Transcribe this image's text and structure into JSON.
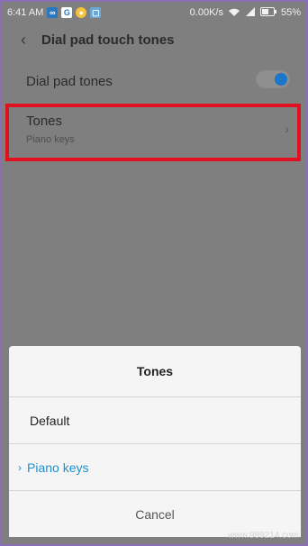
{
  "statusbar": {
    "time": "6:41 AM",
    "speed": "0.00K/s",
    "battery": "55%",
    "icons": [
      "infinity-icon",
      "g-icon",
      "circle-app-icon",
      "square-app-icon",
      "wifi-icon",
      "signal-icon",
      "battery-icon"
    ]
  },
  "appbar": {
    "title": "Dial pad touch tones"
  },
  "settings": {
    "dial_pad_tones": {
      "label": "Dial pad tones",
      "enabled": true
    },
    "tones": {
      "label": "Tones",
      "value": "Piano keys"
    }
  },
  "sheet": {
    "title": "Tones",
    "options": [
      {
        "label": "Default",
        "selected": false
      },
      {
        "label": "Piano keys",
        "selected": true
      }
    ],
    "cancel": "Cancel"
  },
  "watermark": "www.989214.com",
  "colors": {
    "accent": "#1e8fcf",
    "highlight": "#e0101e",
    "toggle_on": "#1976c8"
  }
}
